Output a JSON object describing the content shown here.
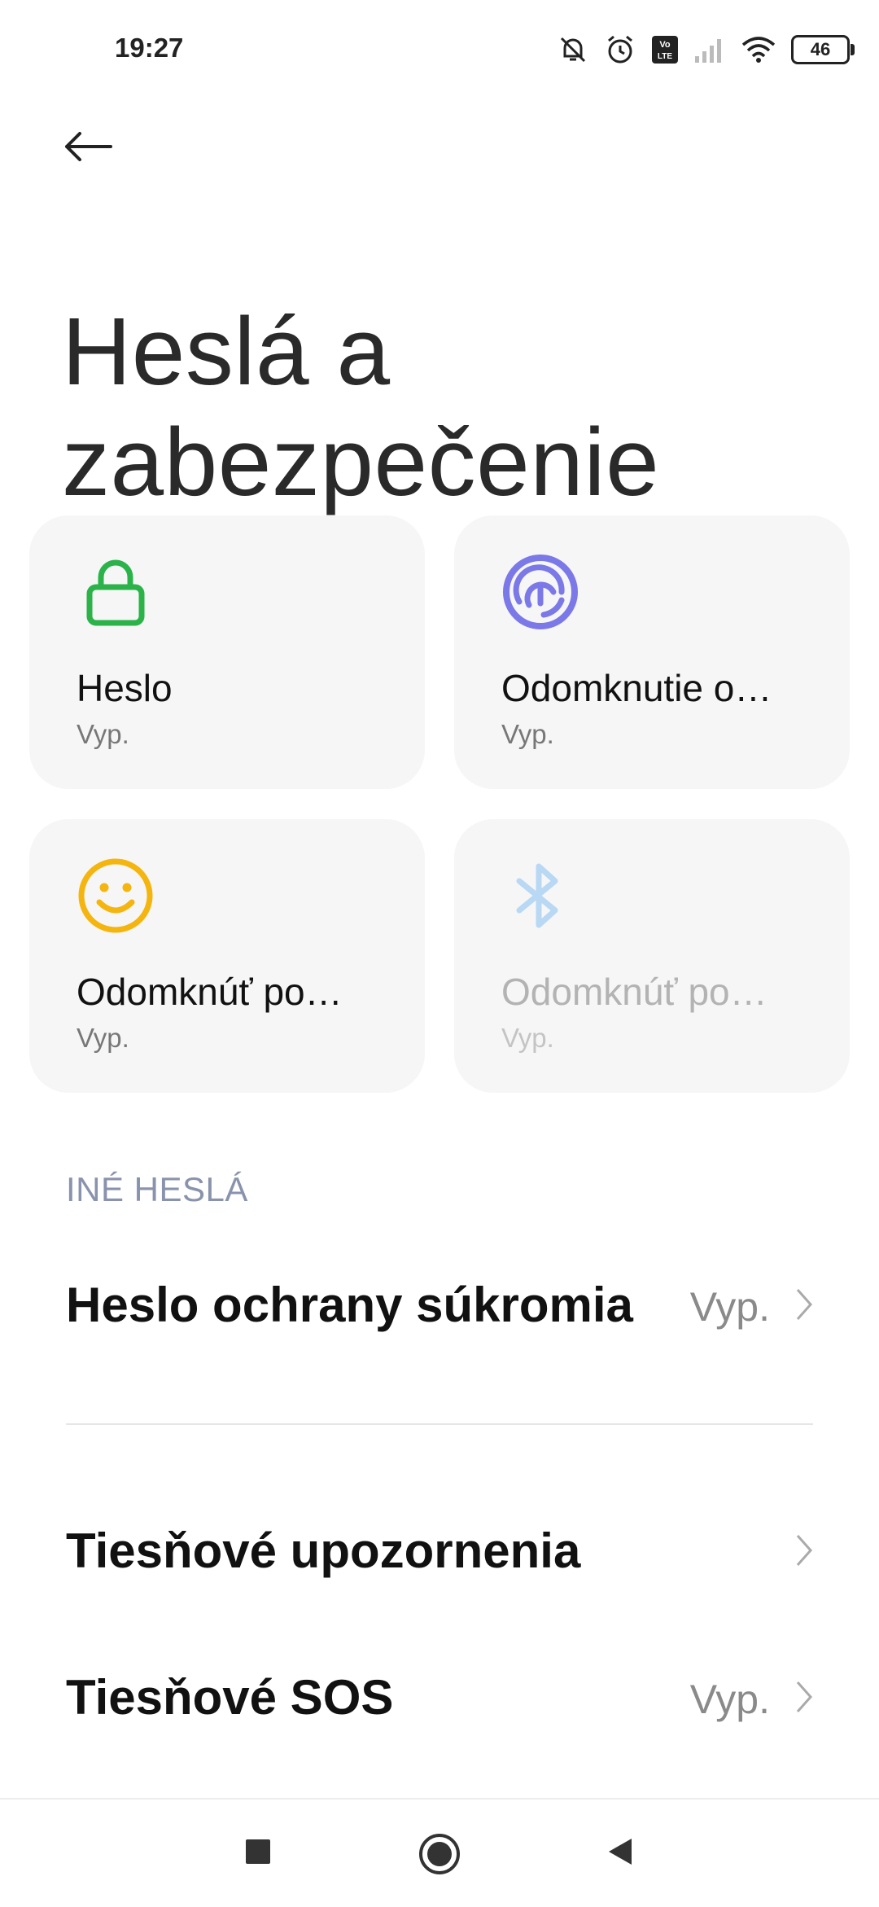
{
  "status_bar": {
    "time": "19:27",
    "battery_level": "46",
    "icons": [
      "notifications-muted-icon",
      "alarm-icon",
      "volte-icon",
      "signal-icon",
      "wifi-icon",
      "battery-icon"
    ]
  },
  "header": {
    "back_icon": "arrow-left-icon",
    "title": "Heslá a zabezpečenie"
  },
  "cards": [
    {
      "title": "Heslo",
      "status": "Vyp.",
      "icon": "lock-icon",
      "color": "#2bb34a",
      "enabled": true
    },
    {
      "title": "Odomknutie o…",
      "status": "Vyp.",
      "icon": "fingerprint-icon",
      "color": "#7b78e8",
      "enabled": true
    },
    {
      "title": "Odomknúť po…",
      "status": "Vyp.",
      "icon": "face-icon",
      "color": "#f5b50f",
      "enabled": true
    },
    {
      "title": "Odomknúť po…",
      "status": "Vyp.",
      "icon": "bluetooth-icon",
      "color": "#b8d8f4",
      "enabled": false
    }
  ],
  "section": {
    "header": "INÉ HESLÁ"
  },
  "rows": [
    {
      "title": "Heslo ochrany súkromia",
      "value": "Vyp."
    },
    {
      "title": "Tiesňové upozornenia",
      "value": ""
    },
    {
      "title": "Tiesňové SOS",
      "value": "Vyp."
    }
  ],
  "nav_bar": {
    "icons": [
      "recents-square-icon",
      "home-circle-icon",
      "back-triangle-icon"
    ]
  },
  "colors": {
    "card_background": "#f6f6f6",
    "section_header": "#8a93ad",
    "secondary_text": "#8a8a8a"
  }
}
